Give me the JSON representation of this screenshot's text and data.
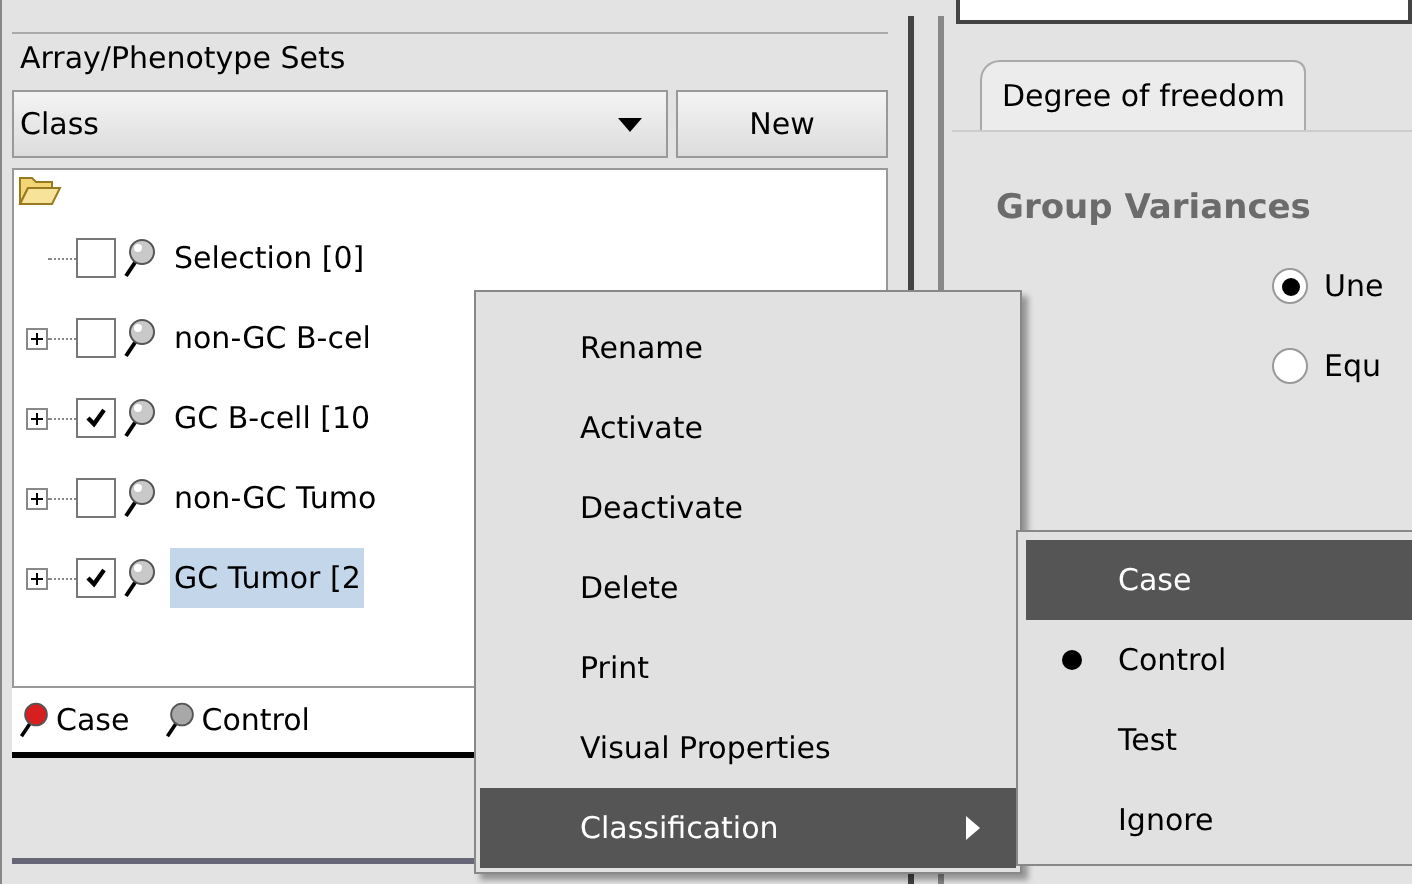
{
  "panel": {
    "title": "Array/Phenotype Sets",
    "dropdown": {
      "value": "Class"
    },
    "new_button": "New"
  },
  "tree": {
    "children": [
      {
        "label": "Selection [0]",
        "checked": false,
        "expandable": false,
        "selected": false
      },
      {
        "label": "non-GC B-cel",
        "checked": false,
        "expandable": true,
        "selected": false
      },
      {
        "label": "GC B-cell [10",
        "checked": true,
        "expandable": true,
        "selected": false
      },
      {
        "label": "non-GC Tumo",
        "checked": false,
        "expandable": true,
        "selected": false
      },
      {
        "label": "GC Tumor [2",
        "checked": true,
        "expandable": true,
        "selected": true
      }
    ]
  },
  "legend": [
    {
      "label": "Case",
      "color": "#d81e1e"
    },
    {
      "label": "Control",
      "color": "#a8a8a8"
    }
  ],
  "right_panel": {
    "tabs": [
      {
        "label": "Degree of freedom"
      }
    ],
    "section_title": "Group Variances",
    "options": [
      {
        "label": "Une",
        "selected": true
      },
      {
        "label": "Equ",
        "selected": false
      }
    ]
  },
  "context_menu": {
    "items": [
      {
        "label": "Rename",
        "highlighted": false,
        "submenu": false
      },
      {
        "label": "Activate",
        "highlighted": false,
        "submenu": false
      },
      {
        "label": "Deactivate",
        "highlighted": false,
        "submenu": false
      },
      {
        "label": "Delete",
        "highlighted": false,
        "submenu": false
      },
      {
        "label": "Print",
        "highlighted": false,
        "submenu": false
      },
      {
        "label": "Visual Properties",
        "highlighted": false,
        "submenu": false
      },
      {
        "label": "Classification",
        "highlighted": true,
        "submenu": true
      }
    ]
  },
  "submenu": {
    "items": [
      {
        "label": "Case",
        "highlighted": true,
        "selected": false
      },
      {
        "label": "Control",
        "highlighted": false,
        "selected": true
      },
      {
        "label": "Test",
        "highlighted": false,
        "selected": false
      },
      {
        "label": "Ignore",
        "highlighted": false,
        "selected": false
      }
    ]
  }
}
